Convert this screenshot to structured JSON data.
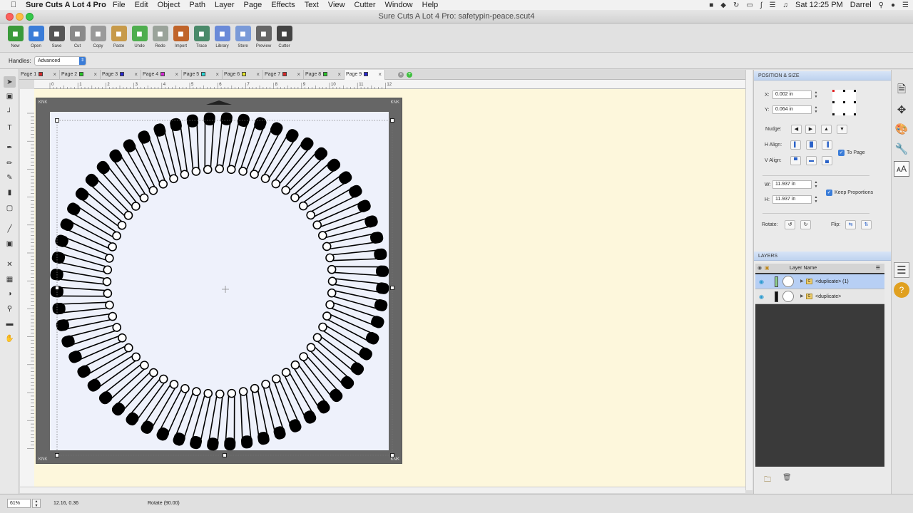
{
  "menubar": {
    "app_name": "Sure Cuts A Lot 4 Pro",
    "menus": [
      "File",
      "Edit",
      "Object",
      "Path",
      "Layer",
      "Page",
      "Effects",
      "Text",
      "View",
      "Cutter",
      "Window",
      "Help"
    ],
    "clock": "Sat 12:25 PM",
    "user": "Darrel"
  },
  "window": {
    "title": "Sure Cuts A Lot 4 Pro: safetypin-peace.scut4"
  },
  "toolbar": {
    "buttons": [
      {
        "label": "New",
        "icon": "new-doc-icon",
        "color": "#3a9a3a"
      },
      {
        "label": "Open",
        "icon": "open-folder-icon",
        "color": "#3b7dd8"
      },
      {
        "label": "Save",
        "icon": "save-disk-icon",
        "color": "#555555"
      },
      {
        "label": "Cut",
        "icon": "scissors-icon",
        "color": "#8a8a8a"
      },
      {
        "label": "Copy",
        "icon": "copy-icon",
        "color": "#9a9a9a"
      },
      {
        "label": "Paste",
        "icon": "paste-icon",
        "color": "#c79a4a"
      },
      {
        "label": "Undo",
        "icon": "undo-icon",
        "color": "#4fae4f"
      },
      {
        "label": "Redo",
        "icon": "redo-icon",
        "color": "#9aa39a"
      },
      {
        "label": "Import",
        "icon": "import-icon",
        "color": "#c0642a"
      },
      {
        "label": "Trace",
        "icon": "trace-icon",
        "color": "#4a8a6a"
      },
      {
        "label": "Library",
        "icon": "library-star-icon",
        "color": "#6a8ad8"
      },
      {
        "label": "Store",
        "icon": "store-icon",
        "color": "#7a9ad8"
      },
      {
        "label": "Preview",
        "icon": "preview-magnifier-icon",
        "color": "#666666"
      },
      {
        "label": "Cutter",
        "icon": "cutter-pen-icon",
        "color": "#444444"
      }
    ]
  },
  "handles": {
    "label": "Handles:",
    "value": "Advanced"
  },
  "tabs": [
    {
      "label": "Page 1",
      "color": "#d42a2a"
    },
    {
      "label": "Page 2",
      "color": "#2ac42a"
    },
    {
      "label": "Page 3",
      "color": "#2a2ad4"
    },
    {
      "label": "Page 4",
      "color": "#d42ad4"
    },
    {
      "label": "Page 5",
      "color": "#2ad4d4"
    },
    {
      "label": "Page 6",
      "color": "#e6e62a"
    },
    {
      "label": "Page 7",
      "color": "#d42a2a"
    },
    {
      "label": "Page 8",
      "color": "#2ac42a"
    },
    {
      "label": "Page 9",
      "color": "#2a2ad4",
      "active": true
    }
  ],
  "ruler": {
    "h_ticks": [
      "0",
      "1",
      "2",
      "3",
      "4",
      "5",
      "6",
      "7",
      "8",
      "9",
      "10",
      "11",
      "12"
    ]
  },
  "mat": {
    "brand": "KNK"
  },
  "position_size": {
    "header": "POSITION & SIZE",
    "x_label": "X:",
    "x_value": "0.002 in",
    "y_label": "Y:",
    "y_value": "0.064 in",
    "nudge_label": "Nudge:",
    "halign_label": "H Align:",
    "valign_label": "V Align:",
    "to_page_label": "To Page",
    "w_label": "W:",
    "w_value": "11.937 in",
    "h_label": "H:",
    "h_value": "11.937 in",
    "keep_proportions_label": "Keep Proportions",
    "rotate_label": "Rotate:",
    "flip_label": "Flip:"
  },
  "layers": {
    "header": "LAYERS",
    "column": "Layer Name",
    "rows": [
      {
        "name": "<duplicate> (1)",
        "color": "#8fd08f",
        "selected": true
      },
      {
        "name": "<duplicate>",
        "color": "#111111",
        "selected": false
      }
    ]
  },
  "status": {
    "zoom": "61%",
    "coords": "12.16, 0.36",
    "message": "Rotate (90.00)"
  }
}
